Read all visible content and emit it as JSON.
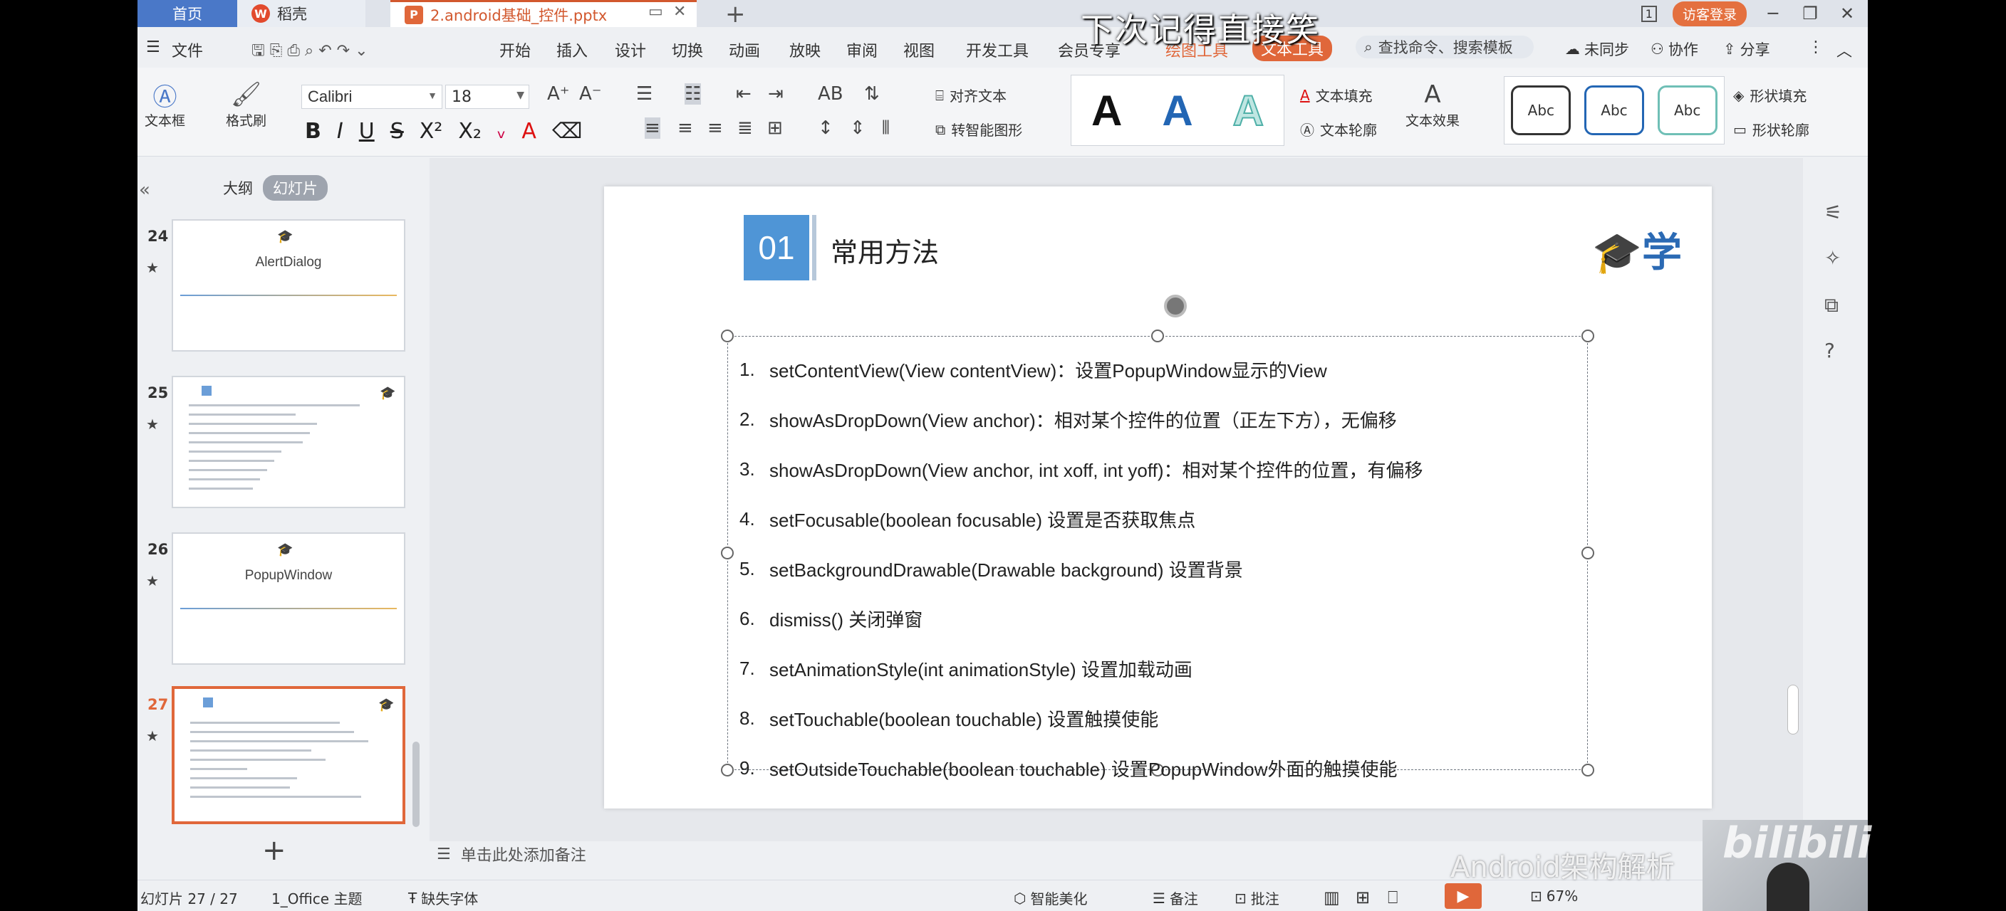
{
  "overlay": {
    "caption": "下次记得直接笑",
    "watermark": "Android架构解析",
    "bili_logo": "bilibili"
  },
  "tabs": {
    "home": "首页",
    "daoke": "稻壳",
    "file": "2.android基础_控件.pptx",
    "daoke_icon": "W",
    "file_icon": "P"
  },
  "titlebar": {
    "page_badge": "1",
    "visitor": "访客登录"
  },
  "menu": {
    "file": "文件",
    "items": [
      "开始",
      "插入",
      "设计",
      "切换",
      "动画",
      "放映",
      "审阅",
      "视图",
      "开发工具",
      "会员专享"
    ],
    "draw_tools": "绘图工具",
    "text_tools": "文本工具",
    "search_placeholder": "查找命令、搜索模板",
    "unsynced": "未同步",
    "collab": "协作",
    "share": "分享"
  },
  "ribbon": {
    "textbox": "文本框",
    "format_painter": "格式刷",
    "font": "Calibri",
    "size": "18",
    "align_text": "对齐文本",
    "smart_shape": "转智能图形",
    "text_fill": "文本填充",
    "text_outline": "文本轮廓",
    "text_effect": "文本效果",
    "shape_fill": "形状填充",
    "shape_outline": "形状轮廓",
    "abc": [
      "Abc",
      "Abc",
      "Abc"
    ],
    "art_letters": [
      "A",
      "A",
      "A"
    ]
  },
  "panel": {
    "outline": "大纲",
    "slides": "幻灯片",
    "thumbs": [
      {
        "num": "24",
        "title": "AlertDialog"
      },
      {
        "num": "25",
        "title": ""
      },
      {
        "num": "26",
        "title": "PopupWindow"
      },
      {
        "num": "27",
        "title": ""
      }
    ]
  },
  "slide": {
    "number": "01",
    "heading": "常用方法",
    "logo": "学",
    "items": [
      {
        "n": "1.",
        "text": "setContentView(View contentView)：设置PopupWindow显示的View"
      },
      {
        "n": "2.",
        "text": "showAsDropDown(View anchor)：相对某个控件的位置（正左下方），无偏移"
      },
      {
        "n": "3.",
        "text": "showAsDropDown(View anchor, int xoff, int yoff)：相对某个控件的位置，有偏移"
      },
      {
        "n": "4.",
        "text": "setFocusable(boolean focusable) 设置是否获取焦点"
      },
      {
        "n": "5.",
        "text": "setBackgroundDrawable(Drawable background) 设置背景"
      },
      {
        "n": "6.",
        "text": "dismiss() 关闭弹窗"
      },
      {
        "n": "7.",
        "text": "setAnimationStyle(int animationStyle) 设置加载动画"
      },
      {
        "n": "8.",
        "text": "setTouchable(boolean touchable) 设置触摸使能"
      },
      {
        "n": "9.",
        "text": "setOutsideTouchable(boolean touchable) 设置PopupWindow外面的触摸使能"
      }
    ]
  },
  "notes": {
    "placeholder": "单击此处添加备注"
  },
  "status": {
    "slide_count": "幻灯片 27 / 27",
    "theme": "1_Office 主题",
    "missing_font": "缺失字体",
    "beautify": "智能美化",
    "notes": "备注",
    "comment": "批注",
    "zoom": "67%"
  },
  "colors": {
    "accent": "#e0673a",
    "blue": "#4f95d6",
    "tab_blue": "#4a78c8"
  }
}
